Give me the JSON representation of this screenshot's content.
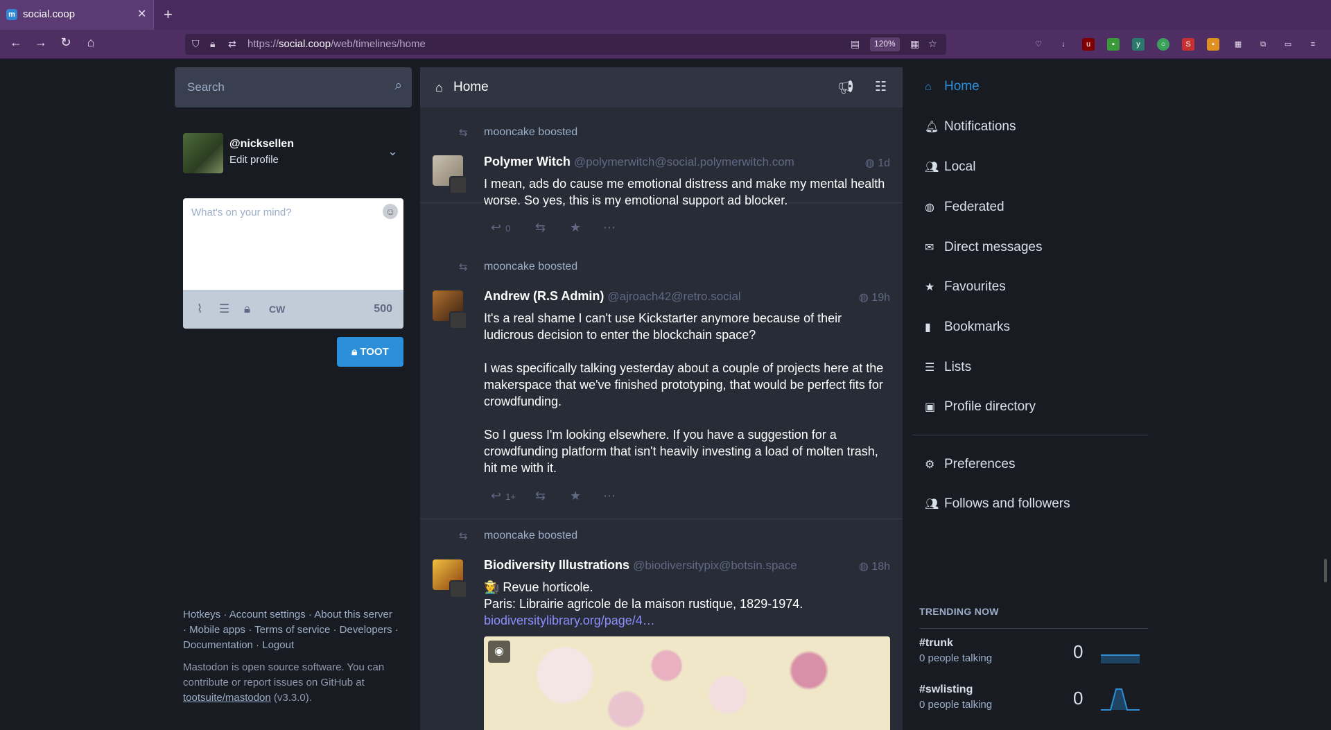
{
  "browser": {
    "tab_title": "social.coop",
    "url_domain": "social.coop",
    "url_prefix": "https://",
    "url_path": "/web/timelines/home",
    "zoom": "120%"
  },
  "search": {
    "placeholder": "Search"
  },
  "profile": {
    "handle": "@nicksellen",
    "edit_label": "Edit profile"
  },
  "compose": {
    "placeholder": "What's on your mind?",
    "cw_label": "CW",
    "char_count": "500",
    "toot_label": "TOOT"
  },
  "footer": {
    "links": [
      "Hotkeys",
      "Account settings",
      "About this server",
      "Mobile apps",
      "Terms of service",
      "Developers",
      "Documentation",
      "Logout"
    ],
    "note_prefix": "Mastodon is open source software. You can contribute or report issues on GitHub at ",
    "repo": "tootsuite/mastodon",
    "version": " (v3.3.0)."
  },
  "timeline": {
    "title": "Home",
    "statuses": [
      {
        "boosted_by": "mooncake boosted",
        "display_name": "Polymer Witch",
        "acct": "@polymerwitch@social.polymerwitch.com",
        "time": "1d",
        "content": [
          "I mean, ads do cause me emotional distress and make my mental health worse. So yes, this is my emotional support ad blocker."
        ],
        "replies": "0"
      },
      {
        "boosted_by": "mooncake boosted",
        "display_name": "Andrew (R.S Admin)",
        "acct": "@ajroach42@retro.social",
        "time": "19h",
        "content": [
          "It's a real shame I can't use Kickstarter anymore because of their ludicrous decision to enter the blockchain space?",
          "I was specifically talking yesterday about a couple of projects here at the makerspace that we've finished prototyping, that would be perfect fits for crowdfunding.",
          "So I guess I'm looking elsewhere. If you have a suggestion for a crowdfunding platform that isn't heavily investing a load of molten trash, hit me with it."
        ],
        "replies": "1+"
      },
      {
        "boosted_by": "mooncake boosted",
        "display_name": "Biodiversity Illustrations",
        "acct": "@biodiversitypix@botsin.space",
        "time": "18h",
        "content": [
          "Revue horticole.",
          "Paris: Librairie agricole de la maison rustique, 1829-1974."
        ],
        "link": "biodiversitylibrary.org/page/4…"
      }
    ]
  },
  "nav": {
    "items": [
      "Home",
      "Notifications",
      "Local",
      "Federated",
      "Direct messages",
      "Favourites",
      "Bookmarks",
      "Lists",
      "Profile directory"
    ],
    "settings": [
      "Preferences",
      "Follows and followers"
    ]
  },
  "trending": {
    "title": "TRENDING NOW",
    "tags": [
      {
        "tag": "#trunk",
        "talking": "0 people talking",
        "count": "0"
      },
      {
        "tag": "#swlisting",
        "talking": "0 people talking",
        "count": "0"
      }
    ]
  },
  "colors": {
    "accent": "#2b90d9",
    "bg": "#191b22",
    "column": "#282c37"
  }
}
